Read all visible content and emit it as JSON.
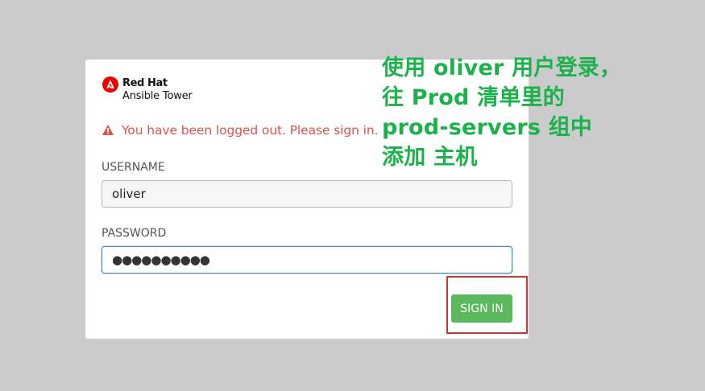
{
  "brand": {
    "line1": "Red Hat",
    "line2": "Ansible Tower",
    "icon": "red-hat-icon",
    "color": "#ee0000"
  },
  "alert": {
    "icon": "warning-icon",
    "text": "You have been logged out. Please sign in.",
    "color": "#d9534f"
  },
  "form": {
    "username_label": "USERNAME",
    "username_value": "oliver",
    "password_label": "PASSWORD",
    "password_value": "●●●●●●●●●●",
    "sign_in_label": "SIGN IN",
    "button_color": "#5cb85c"
  },
  "instruction": {
    "lines": [
      "使用 oliver 用户登录，",
      "往 Prod 清单里的",
      "prod-servers 组中",
      "添加 主机"
    ],
    "color": "#1cb24b"
  },
  "highlight": {
    "color": "#e12d2d"
  }
}
